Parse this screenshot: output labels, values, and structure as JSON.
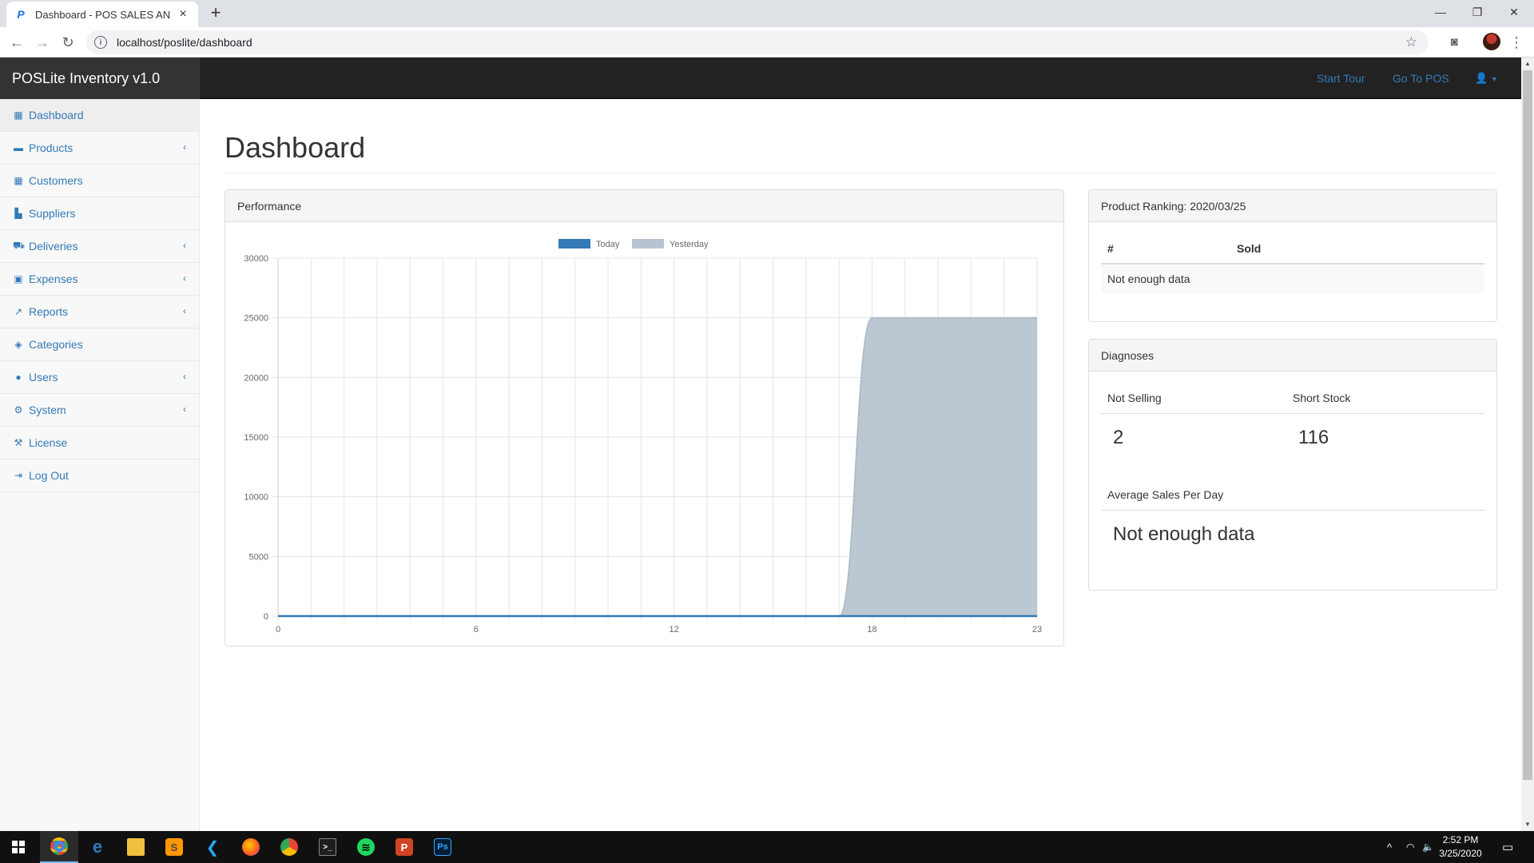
{
  "browser": {
    "tab_title": "Dashboard - POS SALES AND IN",
    "tab_favicon": "P",
    "url": "localhost/poslite/dashboard"
  },
  "header": {
    "brand": "POSLite Inventory v1.0",
    "start_tour": "Start Tour",
    "go_to_pos": "Go To POS"
  },
  "sidebar": {
    "items": [
      {
        "label": "Dashboard",
        "icon": "table-icon",
        "glyph": "▦",
        "chevron": false
      },
      {
        "label": "Products",
        "icon": "briefcase-icon",
        "glyph": "▬",
        "chevron": true
      },
      {
        "label": "Customers",
        "icon": "table-icon",
        "glyph": "▦",
        "chevron": false
      },
      {
        "label": "Suppliers",
        "icon": "bar-chart-icon",
        "glyph": "▙",
        "chevron": false
      },
      {
        "label": "Deliveries",
        "icon": "truck-icon",
        "glyph": "⛟",
        "chevron": true
      },
      {
        "label": "Expenses",
        "icon": "money-icon",
        "glyph": "▣",
        "chevron": true
      },
      {
        "label": "Reports",
        "icon": "line-chart-icon",
        "glyph": "↗",
        "chevron": true
      },
      {
        "label": "Categories",
        "icon": "tags-icon",
        "glyph": "◈",
        "chevron": false
      },
      {
        "label": "Users",
        "icon": "users-icon",
        "glyph": "●",
        "chevron": true
      },
      {
        "label": "System",
        "icon": "gear-icon",
        "glyph": "⚙",
        "chevron": true
      },
      {
        "label": "License",
        "icon": "gavel-icon",
        "glyph": "⚒",
        "chevron": false
      },
      {
        "label": "Log Out",
        "icon": "sign-out-icon",
        "glyph": "⇥",
        "chevron": false
      }
    ]
  },
  "main": {
    "title": "Dashboard",
    "performance": {
      "title": "Performance"
    },
    "ranking": {
      "title": "Product Ranking: 2020/03/25",
      "col_num": "#",
      "col_sold": "Sold",
      "empty": "Not enough data"
    },
    "diagnoses": {
      "title": "Diagnoses",
      "not_selling_label": "Not Selling",
      "not_selling_value": "2",
      "short_stock_label": "Short Stock",
      "short_stock_value": "116",
      "avg_label": "Average Sales Per Day",
      "avg_value": "Not enough data"
    }
  },
  "chart_data": {
    "type": "area",
    "x": [
      0,
      1,
      2,
      3,
      4,
      5,
      6,
      7,
      8,
      9,
      10,
      11,
      12,
      13,
      14,
      15,
      16,
      17,
      18,
      19,
      20,
      21,
      22,
      23
    ],
    "x_ticks": [
      0,
      6,
      12,
      18,
      23
    ],
    "y_ticks": [
      0,
      5000,
      10000,
      15000,
      20000,
      25000,
      30000
    ],
    "ylim": [
      0,
      30000
    ],
    "xlim": [
      0,
      23
    ],
    "grid": true,
    "legend_position": "top",
    "series": [
      {
        "name": "Today",
        "color": "#337ab7",
        "values": [
          0,
          0,
          0,
          0,
          0,
          0,
          0,
          0,
          0,
          0,
          0,
          0,
          0,
          0,
          0,
          0,
          0,
          0,
          0,
          0,
          0,
          0,
          0,
          0
        ]
      },
      {
        "name": "Yesterday",
        "color": "#b7c4cf",
        "values": [
          0,
          0,
          0,
          0,
          0,
          0,
          0,
          0,
          0,
          0,
          0,
          0,
          0,
          0,
          0,
          0,
          0,
          0,
          25000,
          25000,
          25000,
          25000,
          25000,
          25000
        ]
      }
    ]
  },
  "taskbar": {
    "time": "2:52 PM",
    "date": "3/25/2020"
  }
}
